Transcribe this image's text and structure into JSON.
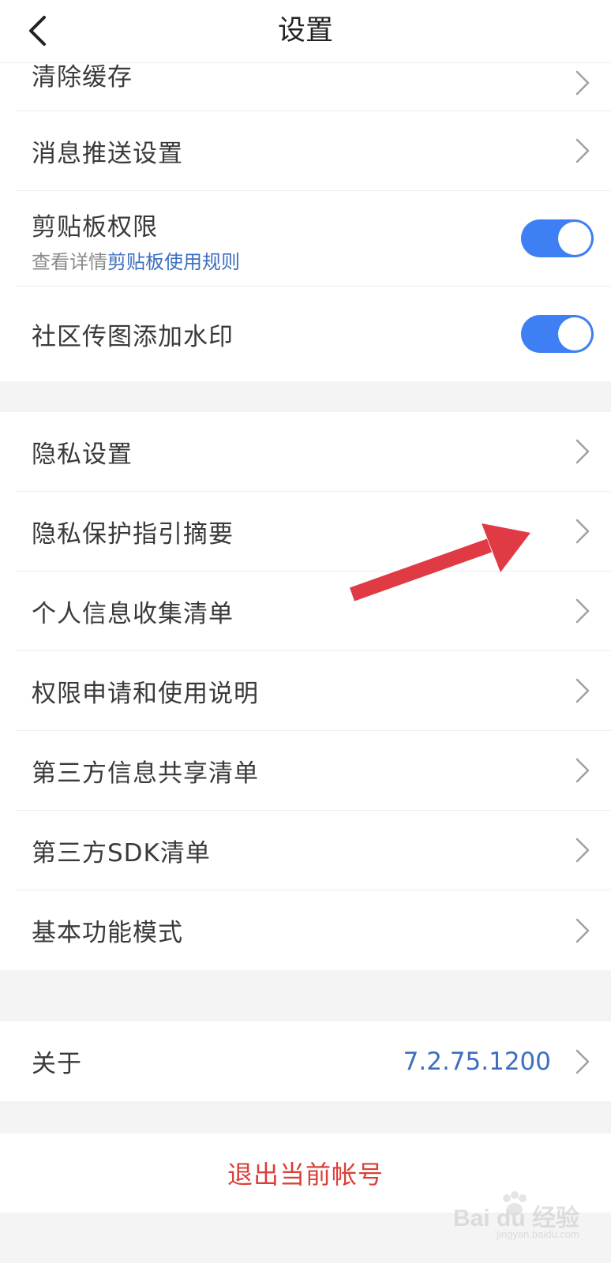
{
  "header": {
    "title": "设置"
  },
  "group1": {
    "items": [
      {
        "label": "清除缓存"
      },
      {
        "label": "消息推送设置"
      },
      {
        "label": "剪贴板权限",
        "sub_prefix": "查看详情",
        "sub_link": "剪贴板使用规则",
        "toggle_on": true
      },
      {
        "label": "社区传图添加水印",
        "toggle_on": true
      }
    ]
  },
  "group2": {
    "items": [
      {
        "label": "隐私设置"
      },
      {
        "label": "隐私保护指引摘要"
      },
      {
        "label": "个人信息收集清单"
      },
      {
        "label": "权限申请和使用说明"
      },
      {
        "label": "第三方信息共享清单"
      },
      {
        "label": "第三方SDK清单"
      },
      {
        "label": "基本功能模式"
      }
    ]
  },
  "group3": {
    "about_label": "关于",
    "version": "7.2.75.1200"
  },
  "logout": {
    "label": "退出当前帐号"
  },
  "watermark": {
    "brand": "Bai du 经验",
    "url": "jingyan.baidu.com"
  },
  "colors": {
    "accent": "#3e7ff3",
    "link": "#3d6fc0",
    "danger": "#d9403a",
    "annotation_arrow": "#e03a44"
  }
}
